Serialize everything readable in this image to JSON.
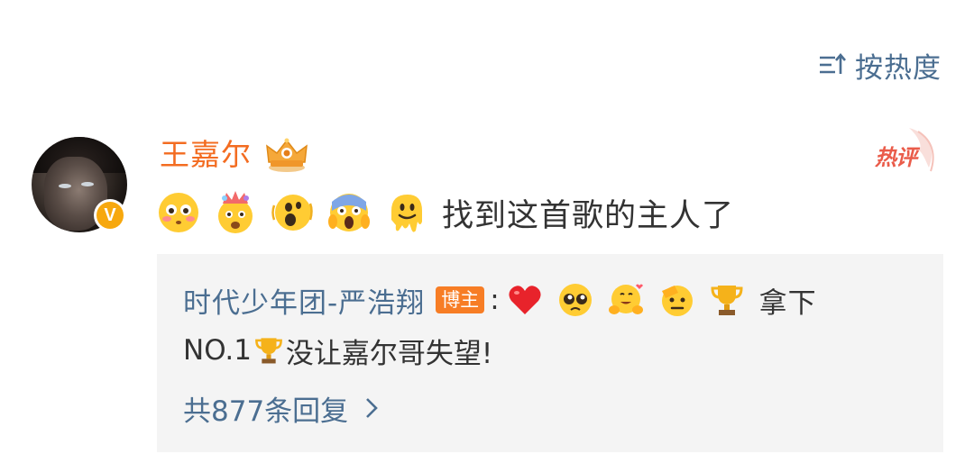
{
  "sort": {
    "label": "按热度",
    "icon": "sort-lines-icon"
  },
  "comment": {
    "avatar_icon": "user-avatar",
    "verified_badge": "V",
    "username": "王嘉尔",
    "crown_icon": "crown-badge-icon",
    "hot_label": "热评",
    "emojis": [
      "flushed-face-emoji",
      "exploding-head-emoji",
      "woozy-face-emoji",
      "screaming-face-emoji",
      "melting-face-emoji"
    ],
    "text": "找到这首歌的主人了"
  },
  "reply": {
    "username": "时代少年团-严浩翔",
    "tag": "博主",
    "colon": ":",
    "emojis": [
      "red-heart-emoji",
      "pleading-face-emoji",
      "hugging-face-emoji",
      "saluting-face-emoji",
      "trophy-emoji"
    ],
    "text_line1": "拿下",
    "text_line2_a": "NO.1",
    "text_line2_b": "没让嘉尔哥失望!",
    "more_label": "共877条回复"
  },
  "colors": {
    "username_orange": "#f36c21",
    "link_blue": "#4b6e91",
    "tag_orange": "#f77d25",
    "hot_red": "#ea5c4a",
    "reply_bg": "#f4f4f4"
  }
}
